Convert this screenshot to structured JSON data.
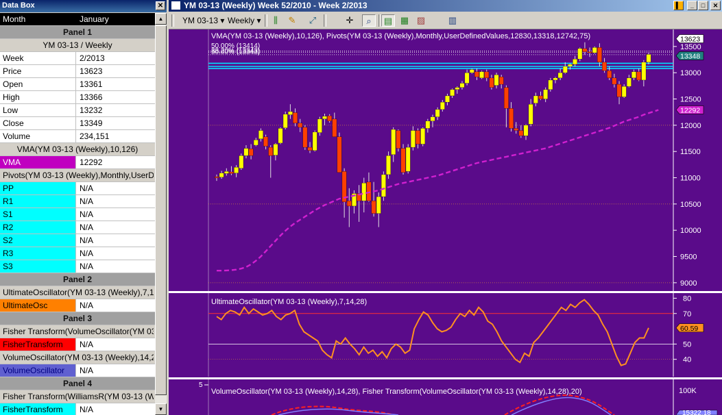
{
  "databox": {
    "title": "Data Box",
    "close_glyph": "✕",
    "rows": [
      {
        "type": "head",
        "k": "Month",
        "v": "January"
      },
      {
        "type": "panel",
        "k": "Panel 1"
      },
      {
        "type": "section",
        "k": "YM 03-13 / Weekly",
        "center": true
      },
      {
        "type": "kv",
        "k": "Week",
        "v": "2/2013"
      },
      {
        "type": "kv",
        "k": "Price",
        "v": "13623"
      },
      {
        "type": "kv",
        "k": "Open",
        "v": "13361"
      },
      {
        "type": "kv",
        "k": "High",
        "v": "13366"
      },
      {
        "type": "kv",
        "k": "Low",
        "v": "13232"
      },
      {
        "type": "kv",
        "k": "Close",
        "v": "13349"
      },
      {
        "type": "kv",
        "k": "Volume",
        "v": "234,151"
      },
      {
        "type": "section",
        "k": "VMA(YM 03-13 (Weekly),10,126)",
        "center": true
      },
      {
        "type": "kv",
        "k": "VMA",
        "v": "12292",
        "color": "#c000c0",
        "fg": "#ffffff"
      },
      {
        "type": "section",
        "k": "Pivots(YM 03-13 (Weekly),Monthly,UserDe"
      },
      {
        "type": "kv",
        "k": "PP",
        "v": "N/A",
        "color": "#00ffff"
      },
      {
        "type": "kv",
        "k": "R1",
        "v": "N/A",
        "color": "#00ffff"
      },
      {
        "type": "kv",
        "k": "S1",
        "v": "N/A",
        "color": "#00ffff"
      },
      {
        "type": "kv",
        "k": "R2",
        "v": "N/A",
        "color": "#00ffff"
      },
      {
        "type": "kv",
        "k": "S2",
        "v": "N/A",
        "color": "#00ffff"
      },
      {
        "type": "kv",
        "k": "R3",
        "v": "N/A",
        "color": "#00ffff"
      },
      {
        "type": "kv",
        "k": "S3",
        "v": "N/A",
        "color": "#00ffff"
      },
      {
        "type": "panel",
        "k": "Panel 2"
      },
      {
        "type": "section",
        "k": "UltimateOscillator(YM 03-13 (Weekly),7,14,"
      },
      {
        "type": "kv",
        "k": "UltimateOsc",
        "v": "N/A",
        "color": "#ff8000"
      },
      {
        "type": "panel",
        "k": "Panel 3"
      },
      {
        "type": "section",
        "k": "Fisher Transform(VolumeOscillator(YM 03-"
      },
      {
        "type": "kv",
        "k": "FisherTransform",
        "v": "N/A",
        "color": "#ff0000"
      },
      {
        "type": "section",
        "k": "VolumeOscillator(YM 03-13 (Weekly),14,28"
      },
      {
        "type": "kv",
        "k": "VolumeOscillator",
        "v": "N/A",
        "color": "#6060d0",
        "fg": "#000080"
      },
      {
        "type": "panel",
        "k": "Panel 4"
      },
      {
        "type": "section",
        "k": "Fisher Transform(WilliamsR(YM 03-13 (We"
      },
      {
        "type": "kv",
        "k": "FisherTransform",
        "v": "N/A",
        "color": "#00ffff"
      }
    ]
  },
  "window": {
    "title": "YM 03-13 (Weekly)  Week 52/2010 - Week 2/2013",
    "min_glyph": "_",
    "max_glyph": "□",
    "close_glyph": "✕"
  },
  "toolbar": {
    "instrument": "YM 03-13 ▾",
    "period": "Weekly ▾",
    "icons": [
      "bar-type",
      "pencil",
      "crosshair-draw",
      "crosshair",
      "zoom",
      "panels",
      "chart-properties",
      "chart-image",
      "data-box"
    ]
  },
  "chart_data": {
    "type": "candlestick",
    "colors": {
      "background": "#5a0b8a",
      "up": "#ffff00",
      "down": "#ff4000",
      "vma": "#d020d0",
      "pivot": "#00e0ff",
      "oscillator": "#ff9020",
      "fisher": "#ff2020",
      "volosc": "#8080ff"
    },
    "price_panel": {
      "title": "VMA(YM 03-13 (Weekly),10,126), Pivots(YM 03-13 (Weekly),Monthly,UserDefinedValues,12830,13318,12742,75)",
      "pivot_labels": [
        "50.00% (13414)",
        "38.20% (13343)",
        "50.00% (13343)"
      ],
      "y_ticks": [
        9000,
        9500,
        10000,
        10500,
        11000,
        11500,
        12000,
        12500,
        13000,
        13500
      ],
      "ylim": [
        8920,
        13720
      ],
      "last_price_flag": "13623",
      "close_flag": "13348",
      "vma_flag": "12292",
      "pivot_lines": [
        13180,
        13120,
        13080
      ],
      "ohlc": [
        [
          11020,
          11060,
          10940,
          11000
        ],
        [
          11010,
          11130,
          10980,
          11090
        ],
        [
          11080,
          11180,
          11040,
          11120
        ],
        [
          11110,
          11220,
          11050,
          11080
        ],
        [
          11090,
          11240,
          11010,
          11200
        ],
        [
          11180,
          11460,
          11150,
          11420
        ],
        [
          11420,
          11620,
          11370,
          11560
        ],
        [
          11550,
          11640,
          11350,
          11420
        ],
        [
          11620,
          11760,
          11600,
          11720
        ],
        [
          11740,
          11940,
          11690,
          11900
        ],
        [
          11780,
          11820,
          11540,
          11600
        ],
        [
          11580,
          11620,
          11000,
          11420
        ],
        [
          11430,
          11660,
          11330,
          11640
        ],
        [
          11660,
          11960,
          11640,
          11940
        ],
        [
          11950,
          12260,
          11920,
          12210
        ],
        [
          12200,
          12400,
          12120,
          12260
        ],
        [
          12240,
          12320,
          11980,
          12040
        ],
        [
          12040,
          12120,
          11870,
          11960
        ],
        [
          11960,
          12000,
          11530,
          11580
        ],
        [
          11580,
          11680,
          11470,
          11520
        ],
        [
          11520,
          11900,
          11500,
          11870
        ],
        [
          11860,
          12160,
          11800,
          12120
        ],
        [
          12120,
          12220,
          12000,
          12170
        ],
        [
          12180,
          12210,
          12050,
          12080
        ],
        [
          12120,
          12240,
          11980,
          11780
        ],
        [
          11780,
          11860,
          11120,
          11100
        ],
        [
          11120,
          11180,
          10240,
          10540
        ],
        [
          10560,
          10800,
          10060,
          10460
        ],
        [
          10460,
          10760,
          10320,
          10700
        ],
        [
          10700,
          10860,
          10160,
          10560
        ],
        [
          10560,
          11000,
          10340,
          10900
        ],
        [
          10920,
          11100,
          10540,
          10560
        ],
        [
          10560,
          10920,
          10260,
          10320
        ],
        [
          10320,
          10720,
          10060,
          10640
        ],
        [
          10640,
          11120,
          10560,
          11060
        ],
        [
          11060,
          11500,
          10980,
          11420
        ],
        [
          11440,
          11960,
          11300,
          11920
        ],
        [
          11900,
          11920,
          11500,
          11560
        ],
        [
          11560,
          11640,
          11060,
          11100
        ],
        [
          11120,
          11640,
          11080,
          11580
        ],
        [
          11580,
          11980,
          11520,
          11900
        ],
        [
          11900,
          11940,
          11560,
          11640
        ],
        [
          11640,
          11960,
          11600,
          11940
        ],
        [
          11940,
          12120,
          11860,
          12080
        ],
        [
          12080,
          12200,
          11960,
          12160
        ],
        [
          12160,
          12340,
          12100,
          12300
        ],
        [
          12300,
          12480,
          12260,
          12440
        ],
        [
          12440,
          12600,
          12380,
          12560
        ],
        [
          12560,
          12700,
          12520,
          12680
        ],
        [
          12680,
          12740,
          12600,
          12720
        ],
        [
          12720,
          12840,
          12680,
          12800
        ],
        [
          12800,
          13060,
          12760,
          13000
        ],
        [
          13000,
          13080,
          12980,
          13060
        ],
        [
          13020,
          13080,
          12860,
          12920
        ],
        [
          12900,
          13040,
          12880,
          13020
        ],
        [
          13020,
          13060,
          12840,
          12900
        ],
        [
          12900,
          12960,
          12680,
          12720
        ],
        [
          12760,
          13000,
          12700,
          12960
        ],
        [
          12920,
          12960,
          12700,
          12780
        ],
        [
          12720,
          12760,
          11960,
          12320
        ],
        [
          12320,
          12440,
          11880,
          11940
        ],
        [
          11940,
          12060,
          11840,
          11900
        ],
        [
          11900,
          12000,
          11760,
          11800
        ],
        [
          11800,
          12020,
          11720,
          12000
        ],
        [
          12020,
          12500,
          11980,
          12400
        ],
        [
          12420,
          12620,
          12360,
          12560
        ],
        [
          12560,
          12640,
          12480,
          12500
        ],
        [
          12500,
          12720,
          12440,
          12680
        ],
        [
          12680,
          12900,
          12640,
          12860
        ],
        [
          12860,
          12920,
          12800,
          12900
        ],
        [
          12900,
          13080,
          12860,
          13000
        ],
        [
          13000,
          13200,
          12980,
          13120
        ],
        [
          13120,
          13180,
          13060,
          13160
        ],
        [
          13160,
          13320,
          13120,
          13260
        ],
        [
          13260,
          13480,
          13220,
          13460
        ],
        [
          13460,
          13580,
          13340,
          13400
        ],
        [
          13400,
          13480,
          13300,
          13380
        ],
        [
          13380,
          13500,
          13360,
          13480
        ],
        [
          13480,
          13560,
          13120,
          13200
        ],
        [
          13200,
          13280,
          13000,
          13040
        ],
        [
          13040,
          13120,
          12860,
          12900
        ],
        [
          12900,
          12980,
          12720,
          12780
        ],
        [
          12780,
          12840,
          12400,
          12540
        ],
        [
          12540,
          12780,
          12520,
          12740
        ],
        [
          12740,
          12960,
          12720,
          12900
        ],
        [
          12900,
          13060,
          12860,
          13020
        ],
        [
          13020,
          13080,
          12840,
          12860
        ],
        [
          12860,
          13240,
          12740,
          13200
        ],
        [
          13200,
          13380,
          13160,
          13349
        ]
      ],
      "vma": [
        9230,
        9230,
        9235,
        9240,
        9250,
        9270,
        9300,
        9350,
        9420,
        9500,
        9600,
        9700,
        9800,
        9900,
        9990,
        10070,
        10140,
        10200,
        10260,
        10320,
        10380,
        10430,
        10480,
        10520,
        10560,
        10600,
        10620,
        10640,
        10660,
        10680,
        10700,
        10720,
        10740,
        10760,
        10790,
        10820,
        10850,
        10880,
        10900,
        10920,
        10940,
        10960,
        10980,
        11000,
        11020,
        11040,
        11070,
        11100,
        11130,
        11160,
        11190,
        11220,
        11250,
        11280,
        11300,
        11320,
        11340,
        11360,
        11380,
        11400,
        11420,
        11440,
        11460,
        11480,
        11500,
        11520,
        11540,
        11560,
        11590,
        11620,
        11650,
        11680,
        11710,
        11740,
        11770,
        11800,
        11830,
        11860,
        11890,
        11920,
        11950,
        11990,
        12030,
        12070,
        12100,
        12130,
        12160,
        12200,
        12230,
        12260,
        12292
      ]
    },
    "ultimate_osc_panel": {
      "title": "UltimateOscillator(YM 03-13 (Weekly),7,14,28)",
      "y_ticks": [
        40,
        50,
        70,
        80
      ],
      "ylim": [
        30,
        82
      ],
      "last_flag": "60.59",
      "values": [
        68,
        66,
        70,
        72,
        71,
        69,
        74,
        70,
        73,
        71,
        69,
        70,
        72,
        68,
        66,
        69,
        70,
        72,
        63,
        58,
        56,
        54,
        52,
        46,
        43,
        41,
        52,
        50,
        54,
        50,
        47,
        43,
        48,
        44,
        46,
        42,
        45,
        41,
        47,
        50,
        48,
        44,
        46,
        60,
        66,
        71,
        69,
        64,
        60,
        58,
        59,
        61,
        66,
        70,
        68,
        72,
        69,
        74,
        71,
        65,
        63,
        58,
        52,
        48,
        44,
        40,
        38,
        44,
        42,
        51,
        54,
        58,
        62,
        66,
        70,
        74,
        72,
        76,
        74,
        77,
        79,
        76,
        72,
        69,
        63,
        58,
        50,
        42,
        36,
        37,
        44,
        51,
        54,
        54,
        60.59
      ]
    },
    "volume_panel": {
      "title": "VolumeOscillator(YM 03-13 (Weekly),14,28), Fisher Transform(VolumeOscillator(YM 03-13 (Weekly),14,28),20)",
      "y_tick": "100K",
      "left_tick": "5",
      "partial_flag": "15322.18"
    }
  }
}
